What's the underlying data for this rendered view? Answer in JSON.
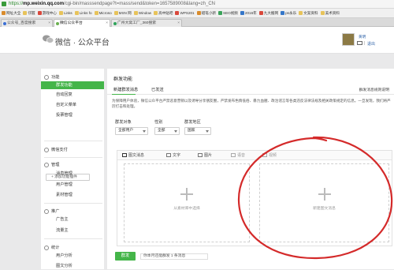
{
  "browser": {
    "url_scheme": "https://",
    "url_domain": "mp.weixin.qq.com",
    "url_rest": "/cgi-bin/masssendpage?t=mass/send&token=1657589008&lang=zh_CN",
    "bookmarks": [
      {
        "label": "网址大全",
        "icon": "star-icon"
      },
      {
        "label": "仔握",
        "icon": "folder-icon"
      },
      {
        "label": "游戏中心",
        "icon": "game-icon"
      },
      {
        "label": "Links",
        "icon": "folder-icon"
      },
      {
        "label": "Links fo",
        "icon": "folder-icon"
      },
      {
        "label": "Microso",
        "icon": "folder-icon"
      },
      {
        "label": "MSN 网",
        "icon": "folder-icon"
      },
      {
        "label": "Window",
        "icon": "folder-icon"
      },
      {
        "label": "高中贴吧",
        "icon": "folder-icon"
      },
      {
        "label": "WPS201",
        "icon": "wps-icon"
      },
      {
        "label": "蜡笔小新",
        "icon": "crayon-icon"
      },
      {
        "label": "SEO视频",
        "icon": "seo-icon"
      },
      {
        "label": "2016年",
        "icon": "year-icon"
      },
      {
        "label": "九大搬网",
        "icon": "site-icon"
      },
      {
        "label": "ps永乐",
        "icon": "ps-icon"
      },
      {
        "label": "文案资料",
        "icon": "doc-icon"
      },
      {
        "label": "美术资料",
        "icon": "art-icon"
      }
    ],
    "tabs": [
      {
        "label": "公众号_百度搜索",
        "active": false
      },
      {
        "label": "微信公众平台",
        "active": true
      },
      {
        "label": "广州大窝工厂_360搜索",
        "active": false
      }
    ]
  },
  "header": {
    "platform_name": "微信 · 公众平台",
    "username": "黄明",
    "divider": "|",
    "exit_label": "退出"
  },
  "sidebar": {
    "sections": [
      {
        "title": "功能",
        "icon": "function-icon",
        "items": [
          {
            "label": "群发功能",
            "active": true
          },
          {
            "label": "自动回复",
            "active": false
          },
          {
            "label": "自定义菜单",
            "active": false
          },
          {
            "label": "投票管理",
            "active": false
          }
        ]
      },
      {
        "title": "微信支付",
        "icon": "wechat-pay-icon",
        "items": []
      },
      {
        "title": "管理",
        "icon": "manage-icon",
        "items": [
          {
            "label": "消息管理",
            "active": false
          },
          {
            "label": "用户管理",
            "active": false
          },
          {
            "label": "素材管理",
            "active": false
          }
        ]
      },
      {
        "title": "推广",
        "icon": "promote-icon",
        "items": [
          {
            "label": "广告主",
            "active": false
          },
          {
            "label": "流量主",
            "active": false
          }
        ]
      },
      {
        "title": "统计",
        "icon": "stats-icon",
        "items": [
          {
            "label": "用户分析",
            "active": false
          },
          {
            "label": "图文分析",
            "active": false
          }
        ]
      }
    ],
    "add_plugin": "+ 添加功能插件"
  },
  "main": {
    "title": "群发功能",
    "subtabs": [
      {
        "label": "新建群发消息",
        "active": true
      },
      {
        "label": "已发送",
        "active": false
      }
    ],
    "right_link": "群发消息规则说明",
    "notice": "为保障用户体验，微信公众平台严禁恶意营销以及诱导分享朋友圈，严禁发布色情低俗、暴力血腥、政治谣言等各类违反法律法规及相关政策规定的信息。一旦发现，我们将严厉打击和处理。",
    "filters": [
      {
        "label": "群发对象",
        "value": "全部用户"
      },
      {
        "label": "性别",
        "value": "全部"
      },
      {
        "label": "群发地区",
        "value": "国家"
      }
    ],
    "toolbar": [
      {
        "label": "图文消息",
        "icon": "article-icon",
        "state": "active"
      },
      {
        "label": "文字",
        "icon": "text-icon",
        "state": "normal"
      },
      {
        "label": "图片",
        "icon": "image-icon",
        "state": "normal"
      },
      {
        "label": "语音",
        "icon": "voice-icon",
        "state": "dim"
      },
      {
        "label": "视频",
        "icon": "video-icon",
        "state": "dim"
      }
    ],
    "from_material": "从素材库中选择",
    "new_article": "新建图文消息",
    "send_label": "群发",
    "remaining": "你本月还能群发 1 条消息"
  },
  "colors": {
    "accent": "#44b549",
    "annotation": "#d42a2a"
  }
}
